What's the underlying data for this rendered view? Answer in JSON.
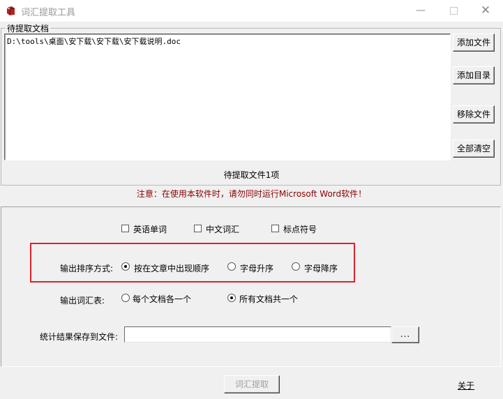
{
  "window": {
    "title": "词汇提取工具",
    "minimize": "—",
    "close": "✕"
  },
  "file_group": {
    "label": "待提取文档",
    "files": [
      "D:\\tools\\桌面\\安下载\\安下载\\安下载说明.doc"
    ],
    "buttons": {
      "add_file": "添加文件",
      "add_dir": "添加目录",
      "remove_file": "移除文件",
      "clear_all": "全部清空"
    },
    "count_text": "待提取文件1项"
  },
  "warning": "注意：在使用本软件时，请勿同时运行Microsoft Word软件！",
  "options": {
    "checkboxes": [
      {
        "label": "英语单词",
        "checked": false
      },
      {
        "label": "中文词汇",
        "checked": false
      },
      {
        "label": "标点符号",
        "checked": false
      }
    ],
    "sort": {
      "label": "输出排序方式:",
      "options": [
        {
          "label": "按在文章中出现顺序",
          "selected": true
        },
        {
          "label": "字母升序",
          "selected": false
        },
        {
          "label": "字母降序",
          "selected": false
        }
      ]
    },
    "vocab": {
      "label": "输出词汇表:",
      "options": [
        {
          "label": "每个文档各一个",
          "selected": false
        },
        {
          "label": "所有文档共一个",
          "selected": true
        }
      ]
    },
    "save": {
      "label": "统计结果保存到文件:",
      "value": "",
      "browse": "..."
    }
  },
  "footer": {
    "extract": "词汇提取",
    "about": "关于"
  },
  "colors": {
    "warning": "#8b0000",
    "highlight_border": "#d9232e",
    "background": "#f0f0f0"
  }
}
